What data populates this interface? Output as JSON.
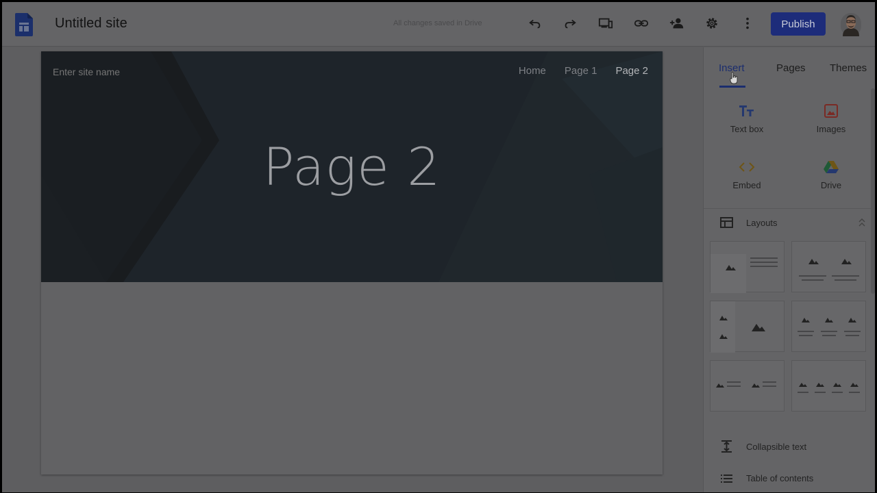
{
  "app": {
    "site_title": "Untitled site",
    "saved_status": "All changes saved in Drive",
    "publish_label": "Publish",
    "accent_color": "#1d2c7a"
  },
  "toolbar": {
    "icons": [
      "undo-icon",
      "redo-icon",
      "device-preview-icon",
      "link-icon",
      "share-icon",
      "settings-icon",
      "more-vert-icon"
    ]
  },
  "site": {
    "name_placeholder": "Enter site name",
    "nav": [
      "Home",
      "Page 1",
      "Page 2"
    ],
    "current_page": "Page 2",
    "heading": "Page 2"
  },
  "panel": {
    "tabs": [
      "Insert",
      "Pages",
      "Themes"
    ],
    "active_tab": "Insert",
    "insert_items": [
      {
        "label": "Text box",
        "icon": "text-box-icon"
      },
      {
        "label": "Images",
        "icon": "image-icon"
      },
      {
        "label": "Embed",
        "icon": "embed-icon"
      },
      {
        "label": "Drive",
        "icon": "drive-icon"
      }
    ],
    "layouts_label": "Layouts",
    "list_items": [
      {
        "label": "Collapsible text",
        "icon": "collapsible-text-icon"
      },
      {
        "label": "Table of contents",
        "icon": "table-of-contents-icon"
      }
    ]
  }
}
